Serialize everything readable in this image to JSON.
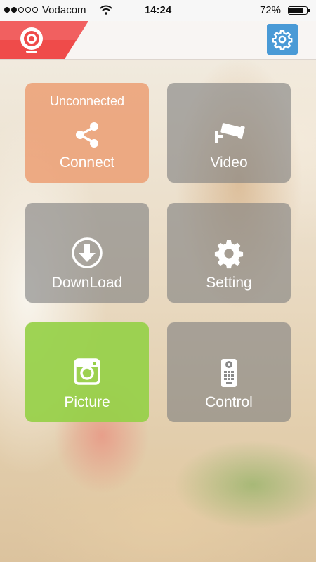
{
  "status_bar": {
    "carrier": "Vodacom",
    "time": "14:24",
    "battery_percent": "72%",
    "signal_bars": 2,
    "signal_total": 5,
    "battery_level": 0.72
  },
  "header": {
    "logo_icon": "camera-lens-logo",
    "settings_icon": "gear-icon",
    "accent_color": "#ef4b4a",
    "settings_button_color": "#4a9ad6"
  },
  "tiles": [
    {
      "label": "Connect",
      "status": "Unconnected",
      "icon": "share-icon",
      "color": "#eca076"
    },
    {
      "label": "Video",
      "icon": "security-camera-icon",
      "color": "#808080"
    },
    {
      "label": "DownLoad",
      "icon": "download-icon",
      "color": "#808080"
    },
    {
      "label": "Setting",
      "icon": "gear-icon",
      "color": "#808080"
    },
    {
      "label": "Picture",
      "icon": "camera-icon",
      "color": "#96d048"
    },
    {
      "label": "Control",
      "icon": "remote-control-icon",
      "color": "#808080"
    }
  ]
}
